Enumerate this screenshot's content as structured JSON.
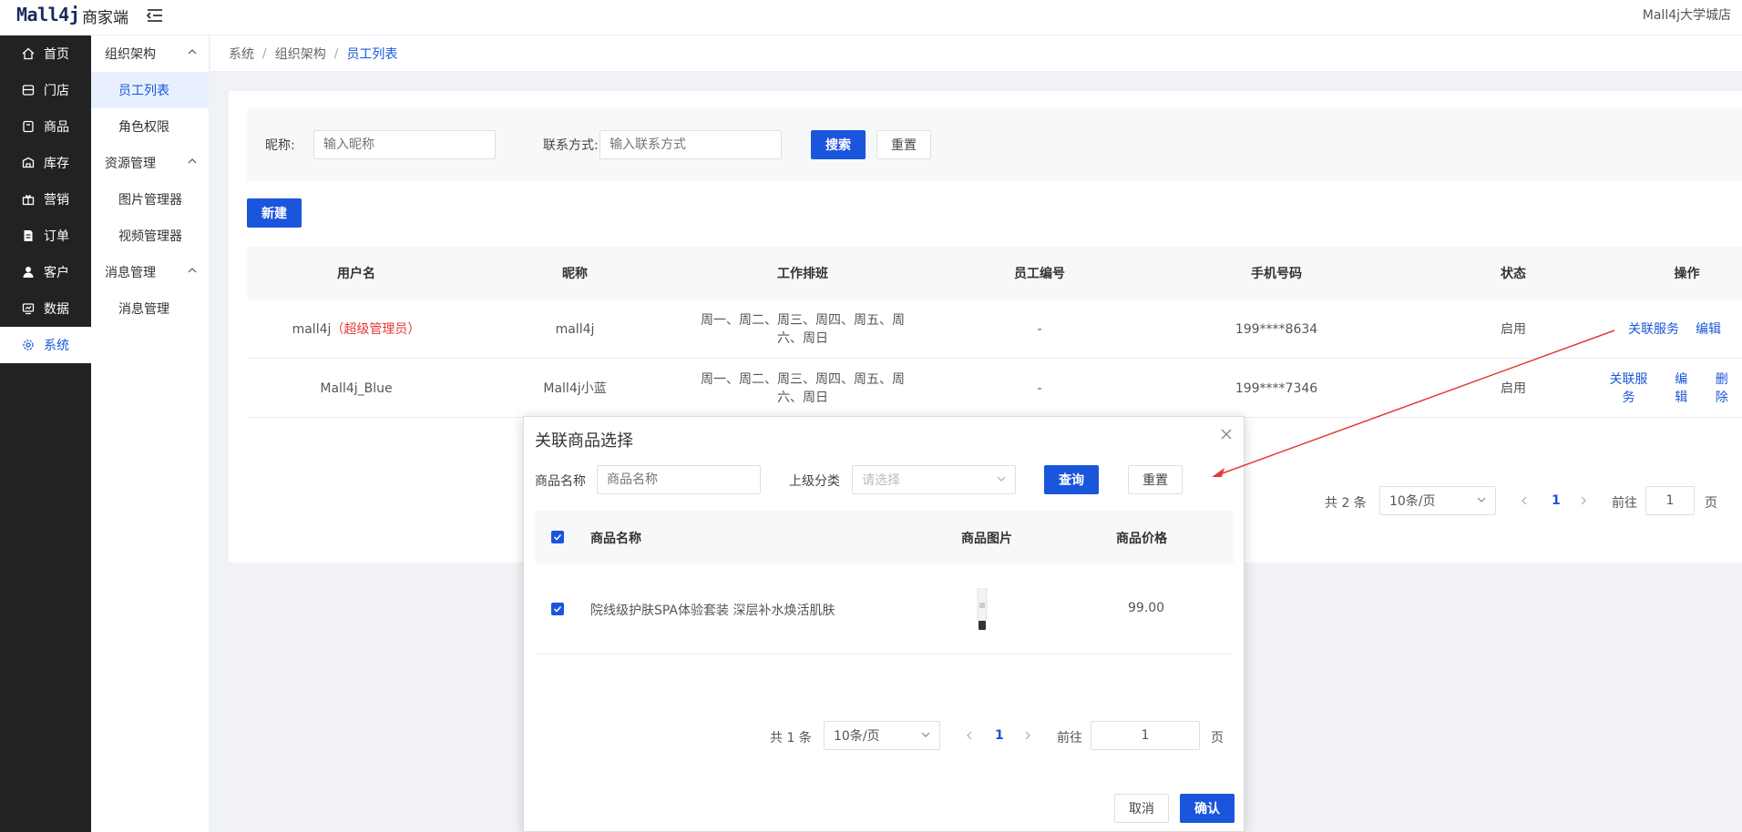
{
  "header": {
    "logo": "Mall4j",
    "logo_sub": "商家端",
    "shop_name": "Mall4j大学城店"
  },
  "sidebar": {
    "items": [
      {
        "label": "首页",
        "icon": "home-icon"
      },
      {
        "label": "门店",
        "icon": "store-icon"
      },
      {
        "label": "商品",
        "icon": "product-icon"
      },
      {
        "label": "库存",
        "icon": "inventory-icon"
      },
      {
        "label": "营销",
        "icon": "gift-icon"
      },
      {
        "label": "订单",
        "icon": "order-icon"
      },
      {
        "label": "客户",
        "icon": "user-icon"
      },
      {
        "label": "数据",
        "icon": "chart-icon"
      },
      {
        "label": "系统",
        "icon": "gear-icon"
      }
    ]
  },
  "subnav": {
    "group1": "组织架构",
    "group1_items": [
      "员工列表",
      "角色权限"
    ],
    "group2": "资源管理",
    "group2_items": [
      "图片管理器",
      "视频管理器"
    ],
    "group3": "消息管理",
    "group3_items": [
      "消息管理"
    ]
  },
  "breadcrumb": [
    "系统",
    "组织架构",
    "员工列表"
  ],
  "search": {
    "nickname_label": "昵称:",
    "nickname_placeholder": "输入昵称",
    "contact_label": "联系方式:",
    "contact_placeholder": "输入联系方式",
    "search_btn": "搜索",
    "reset_btn": "重置"
  },
  "new_btn": "新建",
  "table": {
    "headers": [
      "用户名",
      "昵称",
      "工作排班",
      "员工编号",
      "手机号码",
      "状态",
      "操作"
    ],
    "rows": [
      {
        "username": "mall4j",
        "tag": "（超级管理员）",
        "nickname": "mall4j",
        "schedule_l1": "周一、周二、周三、周四、周五、周",
        "schedule_l2": "六、周日",
        "emp_no": "-",
        "phone": "199****8634",
        "status": "启用",
        "actions": [
          "关联服务",
          "编辑"
        ]
      },
      {
        "username": "Mall4j_Blue",
        "tag": "",
        "nickname": "Mall4j小蓝",
        "schedule_l1": "周一、周二、周三、周四、周五、周",
        "schedule_l2": "六、周日",
        "emp_no": "-",
        "phone": "199****7346",
        "status": "启用",
        "actions": [
          "关联服务",
          "编辑",
          "删除"
        ]
      }
    ]
  },
  "pagination": {
    "total": "共 2 条",
    "page_size": "10条/页",
    "current": "1",
    "goto_label": "前往",
    "goto_value": "1",
    "page_suffix": "页"
  },
  "modal": {
    "title": "关联商品选择",
    "name_label": "商品名称",
    "name_placeholder": "商品名称",
    "category_label": "上级分类",
    "category_placeholder": "请选择",
    "query_btn": "查询",
    "reset_btn": "重置",
    "headers": [
      "商品名称",
      "商品图片",
      "商品价格"
    ],
    "rows": [
      {
        "name": "院线级护肤SPA体验套装 深层补水焕活肌肤",
        "price": "99.00"
      }
    ],
    "pagination": {
      "total": "共 1 条",
      "page_size": "10条/页",
      "current": "1",
      "goto_label": "前往",
      "goto_value": "1",
      "page_suffix": "页"
    },
    "cancel_btn": "取消",
    "confirm_btn": "确认"
  },
  "colors": {
    "primary": "#1a56db",
    "sidebar_bg": "#222222",
    "danger": "#e53935",
    "annotation_arrow": "#e53935"
  }
}
